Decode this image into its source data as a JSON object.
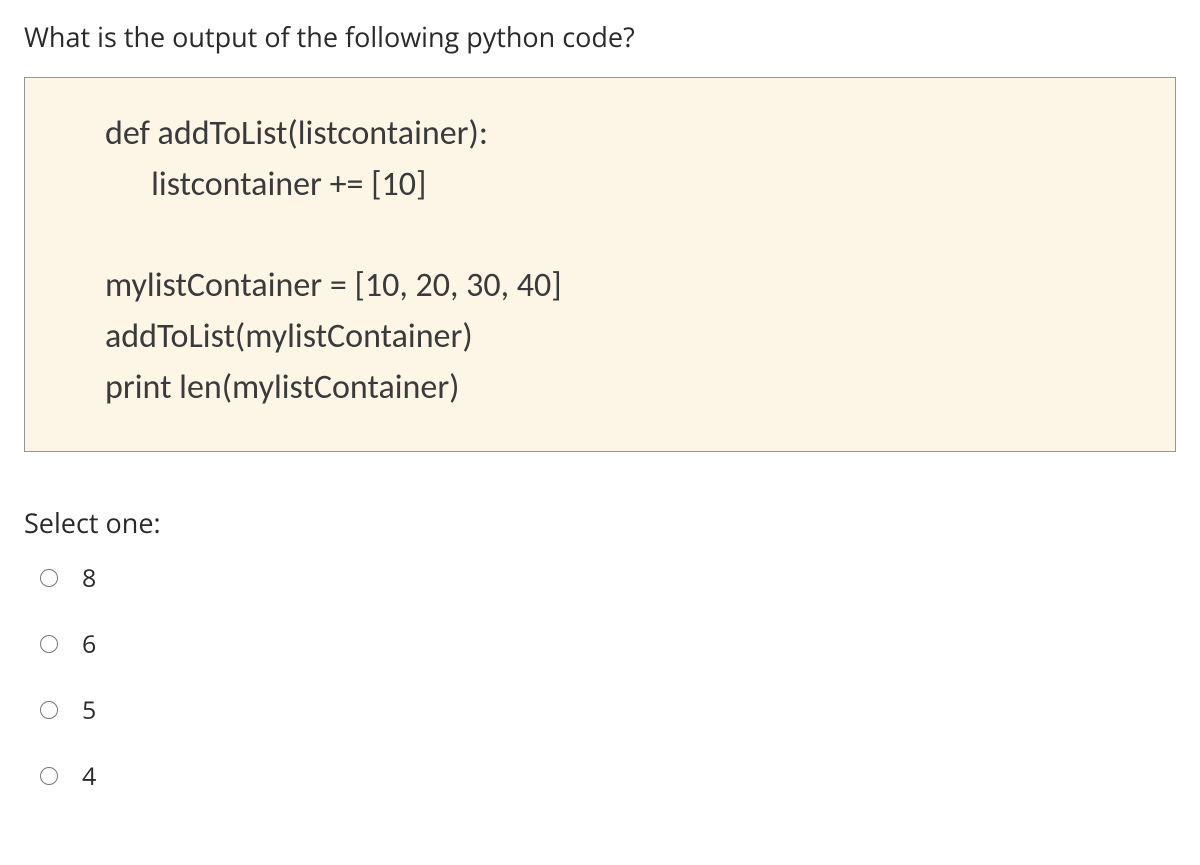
{
  "question": "What is the output of the following python code?",
  "code": {
    "line1": "def addToList(listcontainer):",
    "line2": "      listcontainer += [10]",
    "line3": "mylistContainer = [10, 20, 30, 40]",
    "line4": "addToList(mylistContainer)",
    "line5": "print len(mylistContainer)"
  },
  "select_label": "Select one:",
  "options": [
    {
      "label": "8"
    },
    {
      "label": "6"
    },
    {
      "label": "5"
    },
    {
      "label": "4"
    }
  ]
}
